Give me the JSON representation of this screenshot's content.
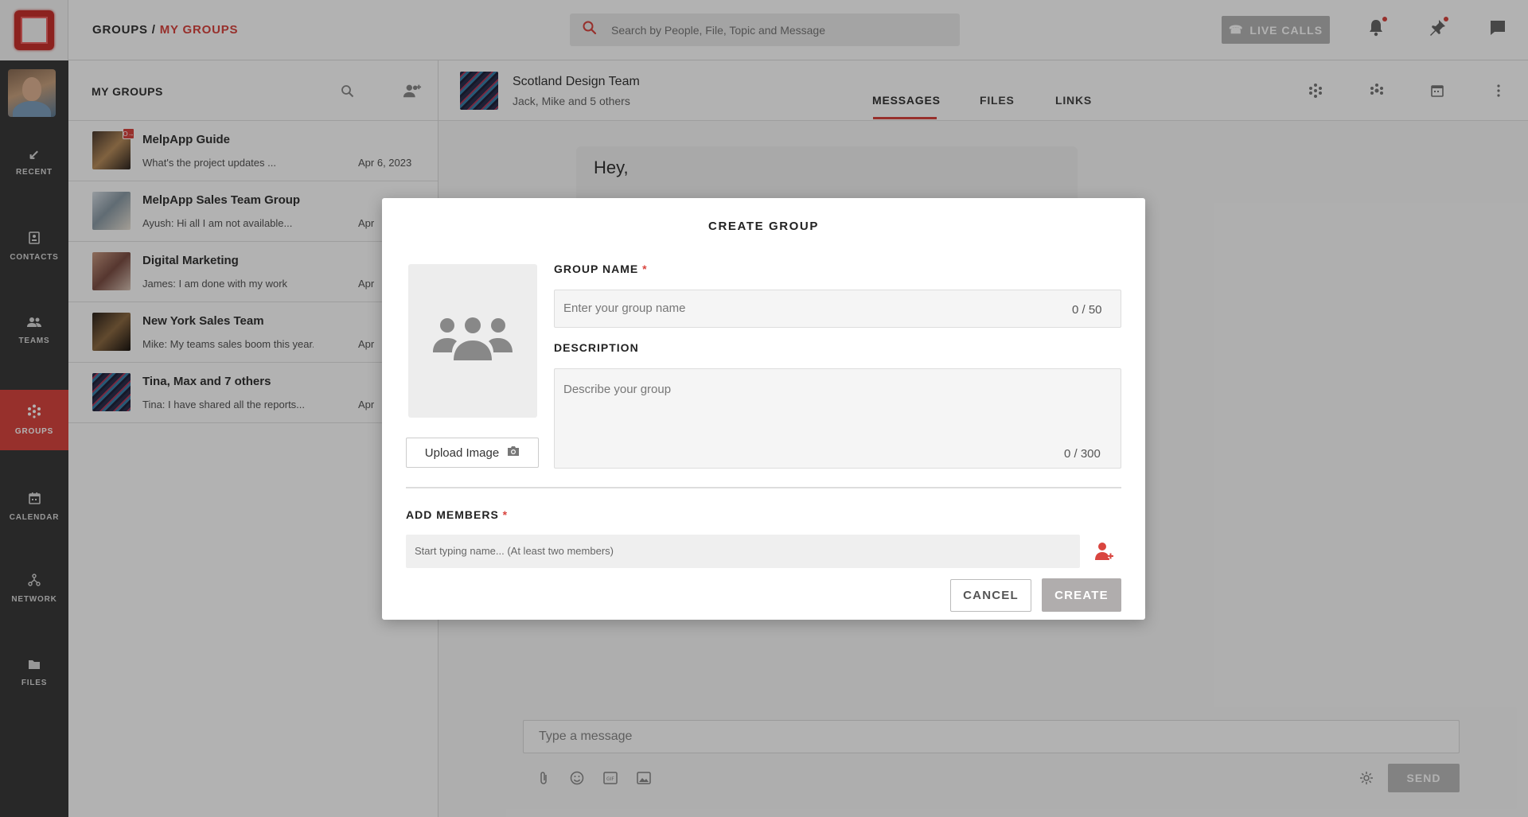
{
  "app": {
    "breadcrumb_root": "GROUPS",
    "breadcrumb_sep": " / ",
    "breadcrumb_current": "MY GROUPS",
    "search_placeholder": "Search by People, File, Topic and Message",
    "live_calls_label": "LIVE CALLS",
    "accent_color": "#d9453f"
  },
  "rail": {
    "items": [
      {
        "label": "RECENT",
        "icon": "arrow-down-left-icon"
      },
      {
        "label": "CONTACTS",
        "icon": "contacts-icon"
      },
      {
        "label": "TEAMS",
        "icon": "teams-icon"
      },
      {
        "label": "GROUPS",
        "icon": "groups-icon",
        "active": true
      },
      {
        "label": "CALENDAR",
        "icon": "calendar-icon"
      },
      {
        "label": "NETWORK",
        "icon": "network-icon"
      },
      {
        "label": "FILES",
        "icon": "folder-icon"
      }
    ]
  },
  "list": {
    "title": "MY GROUPS",
    "groups": [
      {
        "name": "MelpApp Guide",
        "message": "What's the project updates ...",
        "date": "Apr 6, 2023",
        "badge": "O→"
      },
      {
        "name": "MelpApp Sales Team Group",
        "message": "Ayush: Hi all I am not available...",
        "date": "Apr"
      },
      {
        "name": "Digital Marketing",
        "message": "James: I am done with my work",
        "date": "Apr"
      },
      {
        "name": "New York Sales Team",
        "message": "Mike: My teams sales boom this year.",
        "date": "Apr"
      },
      {
        "name": "Tina, Max and 7 others",
        "message": "Tina: I have shared all the reports...",
        "date": "Apr"
      }
    ]
  },
  "conversation": {
    "name": "Scotland Design Team",
    "subtitle": "Jack, Mike and 5 others",
    "tabs": [
      "MESSAGES",
      "FILES",
      "LINKS"
    ],
    "active_tab": "MESSAGES",
    "message_preview": "Hey,",
    "composer_placeholder": "Type a message",
    "send_label": "SEND"
  },
  "modal": {
    "title": "CREATE GROUP",
    "upload_label": "Upload Image",
    "group_name_label": "GROUP NAME",
    "group_name_placeholder": "Enter your group name",
    "group_name_value": "",
    "group_name_counter": "0 / 50",
    "description_label": "DESCRIPTION",
    "description_placeholder": "Describe your group",
    "description_value": "",
    "description_counter": "0 / 300",
    "members_label": "ADD MEMBERS",
    "members_placeholder": "Start typing name... (At least two members)",
    "required_marker": "*",
    "cancel_label": "CANCEL",
    "create_label": "CREATE"
  }
}
